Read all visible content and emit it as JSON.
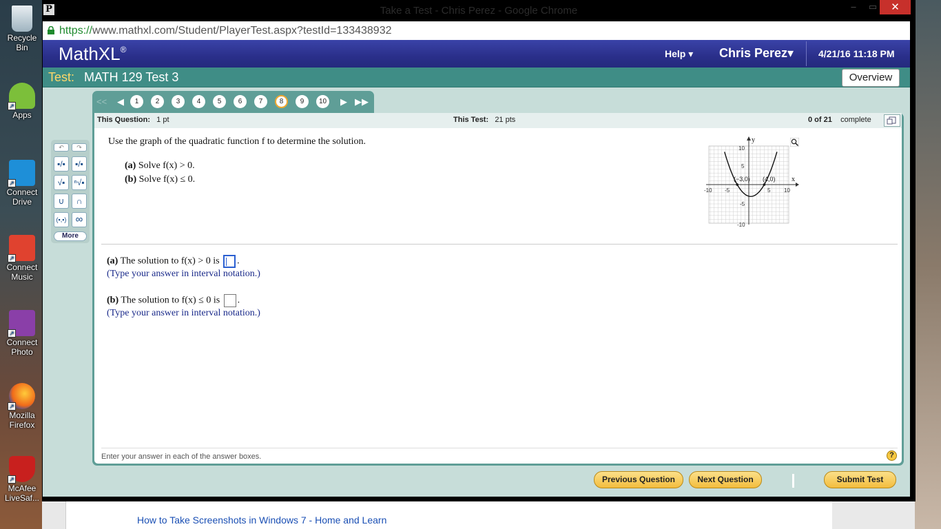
{
  "desktop": {
    "icons": [
      {
        "label": "Recycle Bin",
        "top": 0
      },
      {
        "label": "Apps"
      },
      {
        "label": "Connect Drive"
      },
      {
        "label": "Connect Music"
      },
      {
        "label": "Connect Photo"
      },
      {
        "label": "Mozilla Firefox"
      },
      {
        "label": "McAfee LiveSaf..."
      }
    ]
  },
  "window": {
    "title": "Take a Test - Chris Perez - Google Chrome",
    "close": "✕",
    "minimize": "–",
    "maximize": "▭"
  },
  "address": {
    "scheme": "https://",
    "rest": "www.mathxl.com/Student/PlayerTest.aspx?testId=133438932"
  },
  "header": {
    "logo": "MathXL",
    "logo_mark": "®",
    "help": "Help ▾",
    "user": "Chris Perez▾",
    "datetime": "4/21/16 11:18 PM"
  },
  "testbar": {
    "label": "Test:",
    "name": "MATH 129 Test 3",
    "overview": "Overview"
  },
  "navigator": {
    "first": "<<",
    "prev": "◀",
    "next": "▶",
    "last": "▶▶",
    "questions": [
      "1",
      "2",
      "3",
      "4",
      "5",
      "6",
      "7",
      "8",
      "9",
      "10"
    ],
    "current": "8"
  },
  "info": {
    "this_question_label": "This Question:",
    "this_question_value": "1 pt",
    "this_test_label": "This Test:",
    "this_test_value": "21 pts",
    "progress_count": "0 of 21",
    "progress_word": "complete"
  },
  "tools": {
    "undo": "↶",
    "redo": "↷",
    "more": "More",
    "buttons": [
      [
        "▪/▪",
        "▪/▪"
      ],
      [
        "√▪",
        "ⁿ√▪"
      ],
      [
        "∪",
        "∩"
      ],
      [
        "(▪,▪)",
        "∞"
      ]
    ]
  },
  "question": {
    "prompt": "Use the graph of the quadratic function f to determine the solution.",
    "part_a_label": "(a)",
    "part_a_text": "Solve f(x) > 0.",
    "part_b_label": "(b)",
    "part_b_text": "Solve f(x) ≤ 0.",
    "graph": {
      "y_label": "y",
      "x_label": "x",
      "tick_x_neg10": "-10",
      "tick_x_neg5": "-5",
      "tick_x_5": "5",
      "tick_x_10": "10",
      "tick_y_10": "10",
      "tick_y_5": "5",
      "tick_y_neg5": "-5",
      "tick_y_neg10": "-10",
      "pt1": "(−3,0)",
      "pt2": "(4,0)"
    }
  },
  "answers": {
    "a_label": "(a)",
    "a_text": "The solution to f(x) > 0 is",
    "a_hint": "(Type your answer in interval notation.)",
    "b_label": "(b)",
    "b_text": "The solution to f(x) ≤ 0 is",
    "b_hint": "(Type your answer in interval notation.)",
    "period": "."
  },
  "footer": {
    "instruction": "Enter your answer in each of the answer boxes.",
    "help": "?"
  },
  "buttons": {
    "previous": "Previous Question",
    "next": "Next Question",
    "submit": "Submit Test"
  },
  "below": {
    "link": "How to Take Screenshots in Windows 7 - Home and Learn"
  }
}
